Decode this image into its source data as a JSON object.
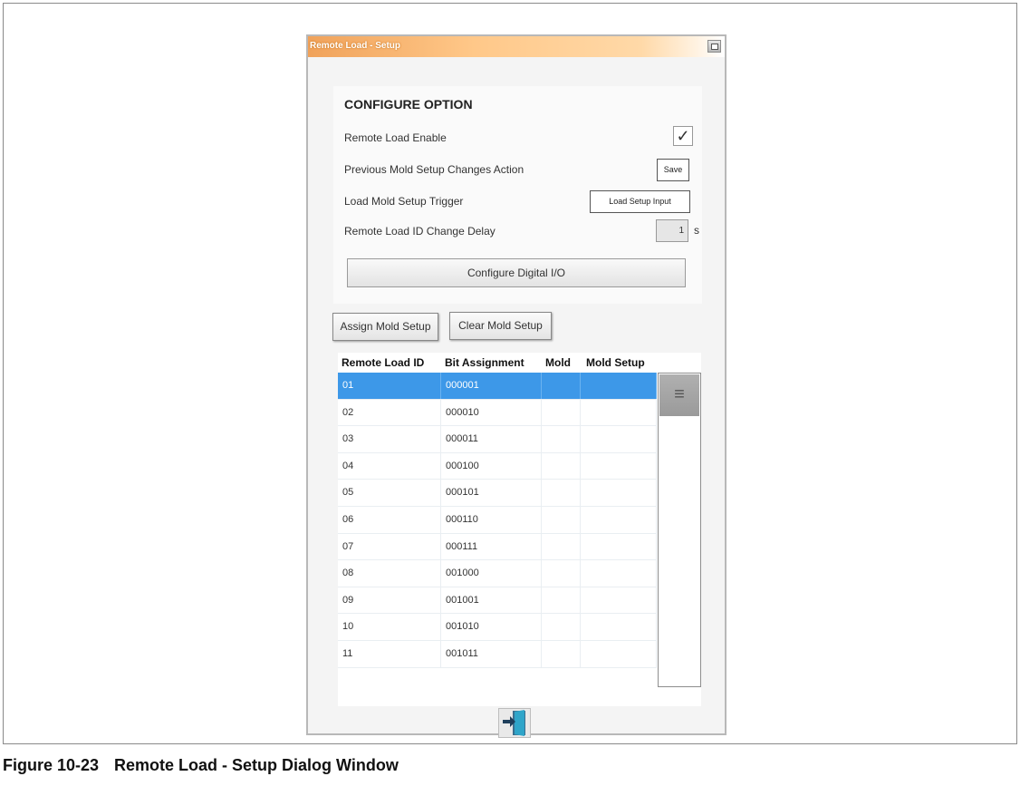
{
  "window": {
    "title": "Remote Load - Setup"
  },
  "config": {
    "heading": "CONFIGURE OPTION",
    "remote_load_enable_label": "Remote Load Enable",
    "remote_load_enable_checked": true,
    "checkmark": "✓",
    "prev_changes_label": "Previous Mold Setup Changes Action",
    "prev_changes_value": "Save",
    "trigger_label": "Load Mold Setup Trigger",
    "trigger_value": "Load Setup Input",
    "delay_label": "Remote Load ID Change Delay",
    "delay_value": "1",
    "delay_unit": "s",
    "configure_io_label": "Configure Digital I/O"
  },
  "actions": {
    "assign_label": "Assign Mold Setup",
    "clear_label": "Clear Mold Setup"
  },
  "table": {
    "headers": [
      "Remote Load ID",
      "Bit Assignment",
      "Mold",
      "Mold Setup"
    ],
    "selected_row": 0,
    "rows": [
      {
        "id": "01",
        "bits": "000001",
        "mold": "",
        "setup": ""
      },
      {
        "id": "02",
        "bits": "000010",
        "mold": "",
        "setup": ""
      },
      {
        "id": "03",
        "bits": "000011",
        "mold": "",
        "setup": ""
      },
      {
        "id": "04",
        "bits": "000100",
        "mold": "",
        "setup": ""
      },
      {
        "id": "05",
        "bits": "000101",
        "mold": "",
        "setup": ""
      },
      {
        "id": "06",
        "bits": "000110",
        "mold": "",
        "setup": ""
      },
      {
        "id": "07",
        "bits": "000111",
        "mold": "",
        "setup": ""
      },
      {
        "id": "08",
        "bits": "001000",
        "mold": "",
        "setup": ""
      },
      {
        "id": "09",
        "bits": "001001",
        "mold": "",
        "setup": ""
      },
      {
        "id": "10",
        "bits": "001010",
        "mold": "",
        "setup": ""
      },
      {
        "id": "11",
        "bits": "001011",
        "mold": "",
        "setup": ""
      }
    ]
  },
  "scrollbar": {
    "thumb_glyph": "≡"
  },
  "icons": {
    "exit": "exit-door-icon",
    "restore": "restore-window-icon"
  },
  "colors": {
    "title_orange": "#f0a25a",
    "selection_blue": "#3d98e8"
  },
  "caption": {
    "number": "Figure 10-23",
    "text": "Remote Load - Setup Dialog Window"
  }
}
